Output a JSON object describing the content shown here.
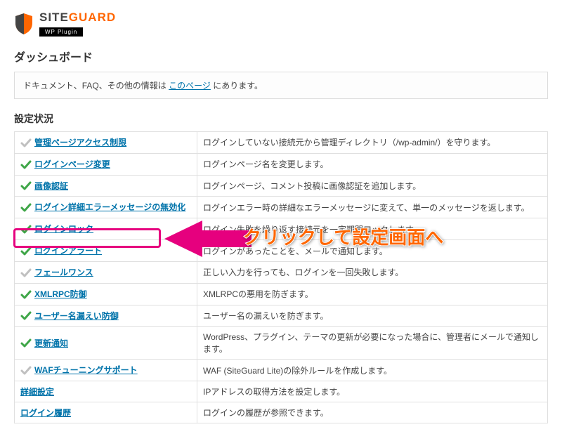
{
  "logo": {
    "name_site": "SITE",
    "name_guard": "GUARD",
    "subtitle": "WP Plugin"
  },
  "heading": "ダッシュボード",
  "notice": {
    "prefix": "ドキュメント、FAQ、その他の情報は ",
    "link_text": "このページ",
    "suffix": " にあります。"
  },
  "section_title": "設定状況",
  "rows": [
    {
      "enabled": false,
      "name": "管理ページアクセス制限",
      "desc": "ログインしていない接続元から管理ディレクトリ（/wp-admin/）を守ります。"
    },
    {
      "enabled": true,
      "name": "ログインページ変更",
      "desc": "ログインページ名を変更します。"
    },
    {
      "enabled": true,
      "name": "画像認証",
      "desc": "ログインページ、コメント投稿に画像認証を追加します。"
    },
    {
      "enabled": true,
      "name": "ログイン詳細エラーメッセージの無効化",
      "desc": "ログインエラー時の詳細なエラーメッセージに変えて、単一のメッセージを返します。"
    },
    {
      "enabled": true,
      "name": "ログインロック",
      "desc": "ログイン失敗を繰り返す接続元を一定期間ロックします。"
    },
    {
      "enabled": true,
      "name": "ログインアラート",
      "desc": "ログインがあったことを、メールで通知します。"
    },
    {
      "enabled": false,
      "name": "フェールワンス",
      "desc": "正しい入力を行っても、ログインを一回失敗します。"
    },
    {
      "enabled": true,
      "name": "XMLRPC防御",
      "desc": "XMLRPCの悪用を防ぎます。"
    },
    {
      "enabled": true,
      "name": "ユーザー名漏えい防御",
      "desc": "ユーザー名の漏えいを防ぎます。"
    },
    {
      "enabled": true,
      "name": "更新通知",
      "desc": "WordPress、プラグイン、テーマの更新が必要になった場合に、管理者にメールで通知します。"
    },
    {
      "enabled": false,
      "name": "WAFチューニングサポート",
      "desc": "WAF (SiteGuard Lite)の除外ルールを作成します。"
    },
    {
      "enabled": null,
      "name": "詳細設定",
      "desc": "IPアドレスの取得方法を設定します。"
    },
    {
      "enabled": null,
      "name": "ログイン履歴",
      "desc": "ログインの履歴が参照できます。"
    }
  ],
  "callout": "クリックして設定画面へ"
}
